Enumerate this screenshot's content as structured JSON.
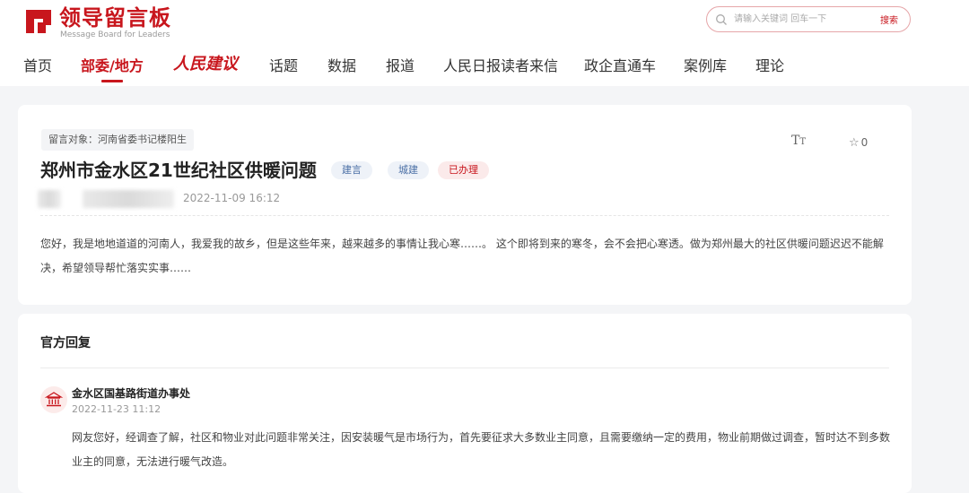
{
  "header": {
    "logo_title": "领导留言板",
    "logo_subtitle": "Message Board for Leaders",
    "search": {
      "placeholder": "请输入关键词 回车一下",
      "button_label": "搜索"
    }
  },
  "nav": {
    "items": [
      {
        "label": "首页",
        "active": false
      },
      {
        "label": "部委/地方",
        "active": true
      },
      {
        "label": "人民建议",
        "active": false
      },
      {
        "label": "话题",
        "active": false
      },
      {
        "label": "数据",
        "active": false
      },
      {
        "label": "报道",
        "active": false
      },
      {
        "label": "人民日报读者来信",
        "active": false
      },
      {
        "label": "政企直通车",
        "active": false
      },
      {
        "label": "案例库",
        "active": false
      },
      {
        "label": "理论",
        "active": false
      }
    ]
  },
  "post": {
    "target_label": "留言对象：河南省委书记楼阳生",
    "title": "郑州市金水区21世纪社区供暖问题",
    "badges": [
      "建言",
      "城建",
      "已办理"
    ],
    "datetime": "2022-11-09 16:12",
    "favorite_count": "0",
    "body": "您好，我是地地道道的河南人，我爱我的故乡，但是这些年来，越来越多的事情让我心寒……。 这个即将到来的寒冬，会不会把心寒透。做为郑州最大的社区供暖问题迟迟不能解决，希望领导帮忙落实实事……"
  },
  "reply": {
    "heading": "官方回复",
    "org_name": "金水区国基路街道办事处",
    "datetime": "2022-11-23 11:12",
    "body": "网友您好，经调查了解，社区和物业对此问题非常关注，因安装暖气是市场行为，首先要征求大多数业主同意，且需要缴纳一定的费用，物业前期做过调查，暂时达不到多数业主的同意，无法进行暖气改造。"
  },
  "colors": {
    "brand_red": "#c8161d",
    "page_bg": "#f4f5f7",
    "tag_blue": "#4a6fa5"
  },
  "icons": [
    "logo-mark-icon",
    "search-icon",
    "font-size-icon",
    "star-icon",
    "institution-icon"
  ]
}
